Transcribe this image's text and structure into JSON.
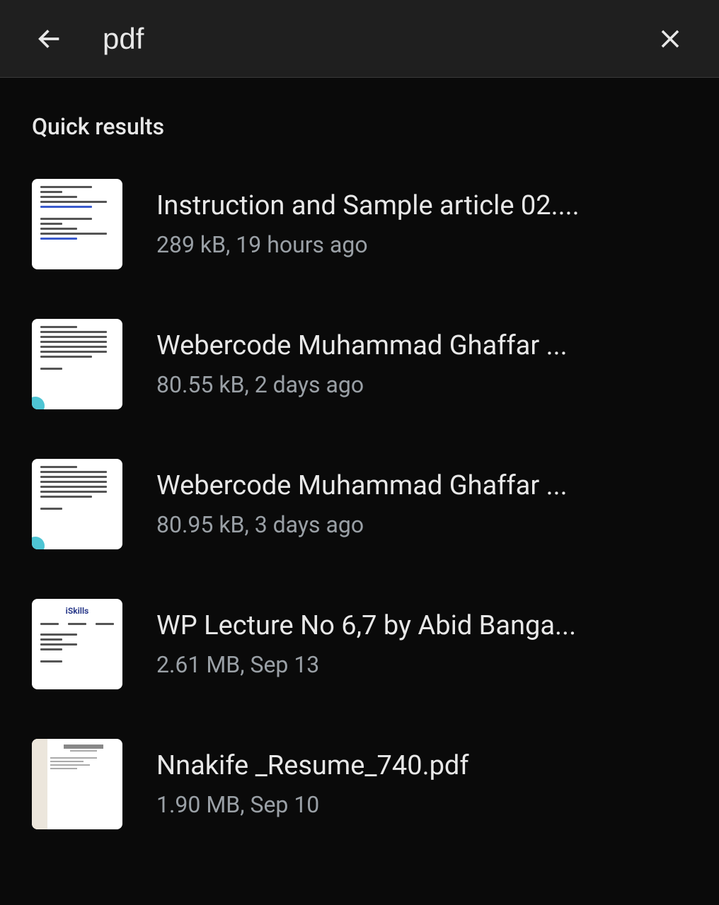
{
  "search": {
    "query": "pdf"
  },
  "section_title": "Quick results",
  "results": [
    {
      "title": "Instruction and Sample article 02....",
      "meta": "289 kB, 19 hours ago",
      "thumb_type": "doc1"
    },
    {
      "title": "Webercode Muhammad Ghaffar ...",
      "meta": "80.55 kB, 2 days ago",
      "thumb_type": "doc2"
    },
    {
      "title": "Webercode Muhammad Ghaffar ...",
      "meta": "80.95 kB, 3 days ago",
      "thumb_type": "doc2"
    },
    {
      "title": "WP Lecture No 6,7 by Abid Banga...",
      "meta": "2.61 MB, Sep 13",
      "thumb_type": "doc3",
      "thumb_header": "iSkills"
    },
    {
      "title": "Nnakife _Resume_740.pdf",
      "meta": "1.90 MB, Sep 10",
      "thumb_type": "doc4"
    }
  ]
}
